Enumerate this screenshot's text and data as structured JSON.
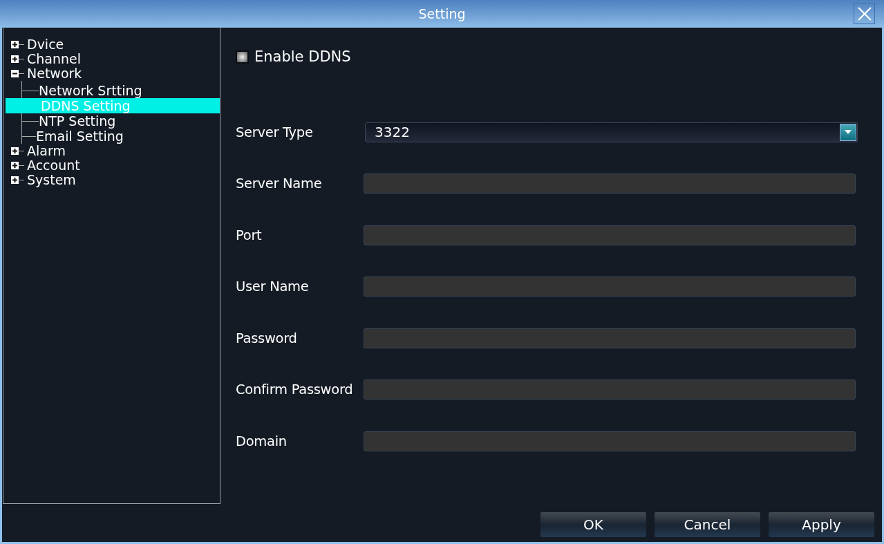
{
  "window": {
    "title": "Setting"
  },
  "tree": [
    {
      "label": "Dvice",
      "expanded": false
    },
    {
      "label": "Channel",
      "expanded": false
    },
    {
      "label": "Network",
      "expanded": true,
      "children": [
        {
          "label": "Network Srtting",
          "selected": false
        },
        {
          "label": "DDNS Setting",
          "selected": true
        },
        {
          "label": "NTP Setting",
          "selected": false
        },
        {
          "label": "Email Setting",
          "selected": false
        }
      ]
    },
    {
      "label": "Alarm",
      "expanded": false
    },
    {
      "label": "Account",
      "expanded": false
    },
    {
      "label": "System",
      "expanded": false
    }
  ],
  "enable": {
    "label": "Enable DDNS",
    "checked": false
  },
  "fields": [
    {
      "kind": "select",
      "label": "Server Type",
      "value": "3322"
    },
    {
      "kind": "text",
      "label": "Server Name"
    },
    {
      "kind": "text",
      "label": "Port"
    },
    {
      "kind": "text",
      "label": "User Name"
    },
    {
      "kind": "text",
      "label": "Password"
    },
    {
      "kind": "text",
      "label": "Confirm Password"
    },
    {
      "kind": "text",
      "label": "Domain"
    }
  ],
  "buttons": [
    "OK",
    "Cancel",
    "Apply"
  ]
}
